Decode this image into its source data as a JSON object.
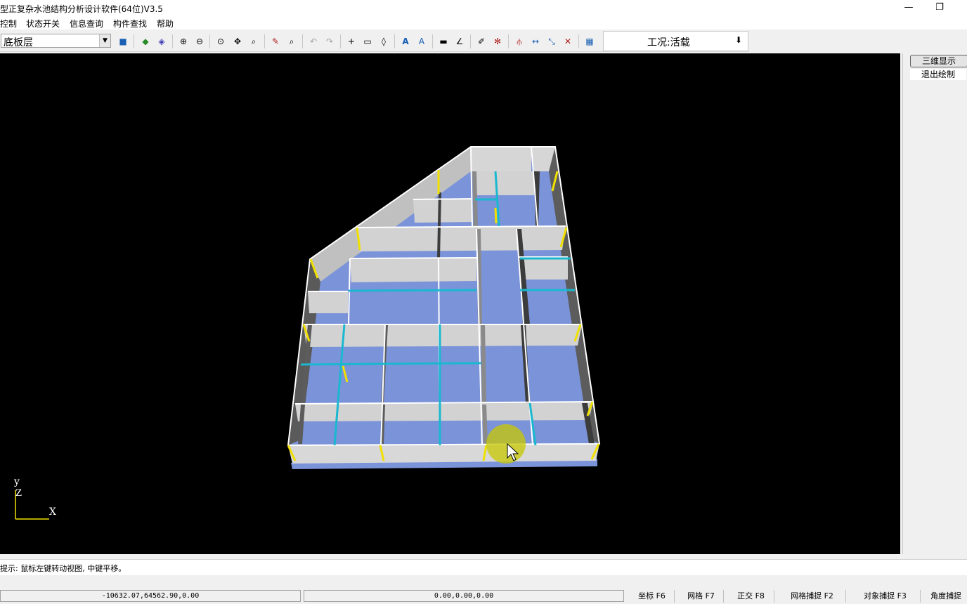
{
  "window": {
    "title": "型正复杂水池结构分析设计软件(64位)V3.5",
    "minimize": "—",
    "restore": "❐"
  },
  "menu": [
    "控制",
    "状态开关",
    "信息查询",
    "构件查找",
    "帮助"
  ],
  "toolbar": {
    "layer": "底板层",
    "condition": "工况:活载",
    "condition_icon": "down-arrow-icon"
  },
  "right_panel": {
    "three_d": "三维显示",
    "exit_draw": "退出绘制"
  },
  "axes": {
    "y": "y",
    "z": "Z",
    "x": "X"
  },
  "status": {
    "hint": "提示: 鼠标左键转动视图, 中键平移。"
  },
  "coords": {
    "cursor": "-10632.07,64562.90,0.00",
    "base": "0.00,0.00,0.00"
  },
  "toggles": [
    "坐标 F6",
    "网格 F7",
    "正交 F8",
    "网格捕捉 F2",
    "对象捕捉 F3",
    "角度捕捉"
  ],
  "colors": {
    "wall": "#d2d2d2",
    "floor": "#7b93d8",
    "beam": "#1ab8d0",
    "column": "#f0e000",
    "highlight": "#c8c800"
  }
}
